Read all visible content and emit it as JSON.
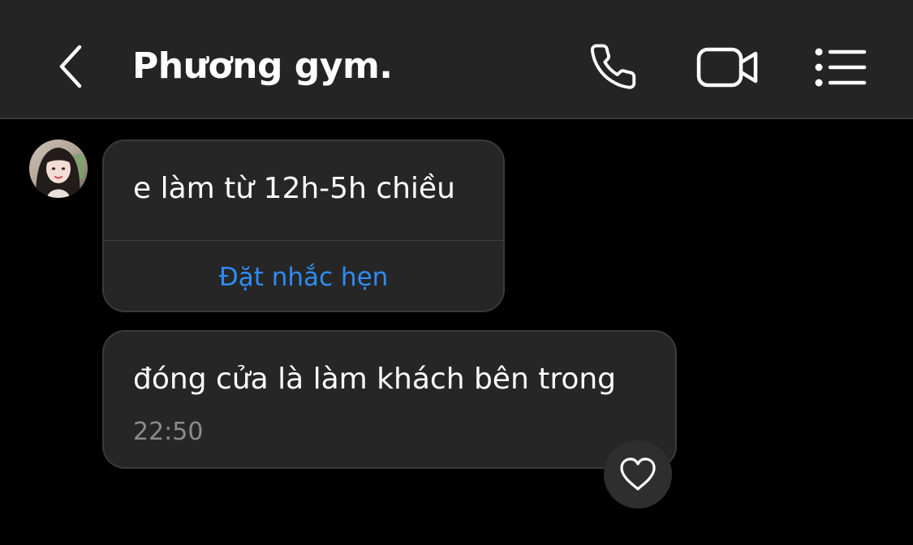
{
  "header": {
    "back_icon": "chevron-left-icon",
    "title": "Phương gym.",
    "actions": [
      {
        "icon": "phone-icon"
      },
      {
        "icon": "video-camera-icon"
      },
      {
        "icon": "list-menu-icon"
      }
    ],
    "background": "#242424"
  },
  "conversation": {
    "messages": [
      {
        "text": "e làm từ 12h-5h chiều",
        "action_label": "Đặt nhắc hẹn"
      },
      {
        "text": "đóng cửa là làm khách bên trong",
        "time": "22:50",
        "reaction_icon": "heart-outline-icon"
      }
    ]
  },
  "colors": {
    "background": "#000000",
    "bubble": "#262626",
    "accent_link": "#2f8cf3",
    "timestamp": "#8c8c8c"
  }
}
